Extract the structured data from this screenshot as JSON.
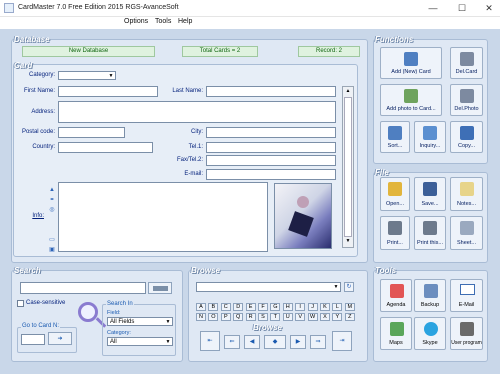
{
  "window": {
    "title": "CardMaster 7.0 Free Edition 2015 RGS-AvanceSoft",
    "minimize": "—",
    "maximize": "☐",
    "close": "✕"
  },
  "menu": [
    "Options",
    "Tools",
    "Help"
  ],
  "database": {
    "title": "Database",
    "new_db": "New Database",
    "total": "Total Cards = 2",
    "record": "Record: 2"
  },
  "card": {
    "title": "Card",
    "category": "Category:",
    "first_name": "First Name:",
    "last_name": "Last Name:",
    "address": "Address:",
    "postal": "Postal code:",
    "city": "City:",
    "country": "Country:",
    "tel": "Tel.1:",
    "fax": "Fax/Tel.2:",
    "email": "E-mail:",
    "info": "Info:"
  },
  "functions": {
    "title": "Functions",
    "buttons": [
      "Add (New) Card",
      "Del.Card",
      "Add photo to Card...",
      "Del.Photo",
      "Sort...",
      "Inquiry...",
      "Copy..."
    ]
  },
  "file": {
    "title": "File",
    "buttons": [
      "Open...",
      "Save...",
      "Notes...",
      "Print...",
      "Print this...",
      "Sheet..."
    ]
  },
  "search": {
    "title": "Search",
    "case_sensitive": "Case-sensitive",
    "search_in": "Search In",
    "field_lbl": "Field:",
    "field_val": "All Fields",
    "category_lbl": "Category:",
    "category_val": "All",
    "goto": "Go to Card N:"
  },
  "browse": {
    "title": "Browse",
    "letters": [
      "A",
      "B",
      "C",
      "D",
      "E",
      "F",
      "G",
      "H",
      "I",
      "J",
      "K",
      "L",
      "M",
      "N",
      "O",
      "P",
      "Q",
      "R",
      "S",
      "T",
      "U",
      "V",
      "W",
      "X",
      "Y",
      "Z"
    ],
    "nav_title": "Browse"
  },
  "tools": {
    "title": "Tools",
    "buttons": [
      "Agenda",
      "Backup",
      "E-Mail",
      "Maps",
      "Skype",
      "User program"
    ]
  },
  "colors": {
    "bg": "#c9d7e9",
    "panel": "#dfe8f4",
    "label": "#001e7a",
    "green": "#116611"
  }
}
